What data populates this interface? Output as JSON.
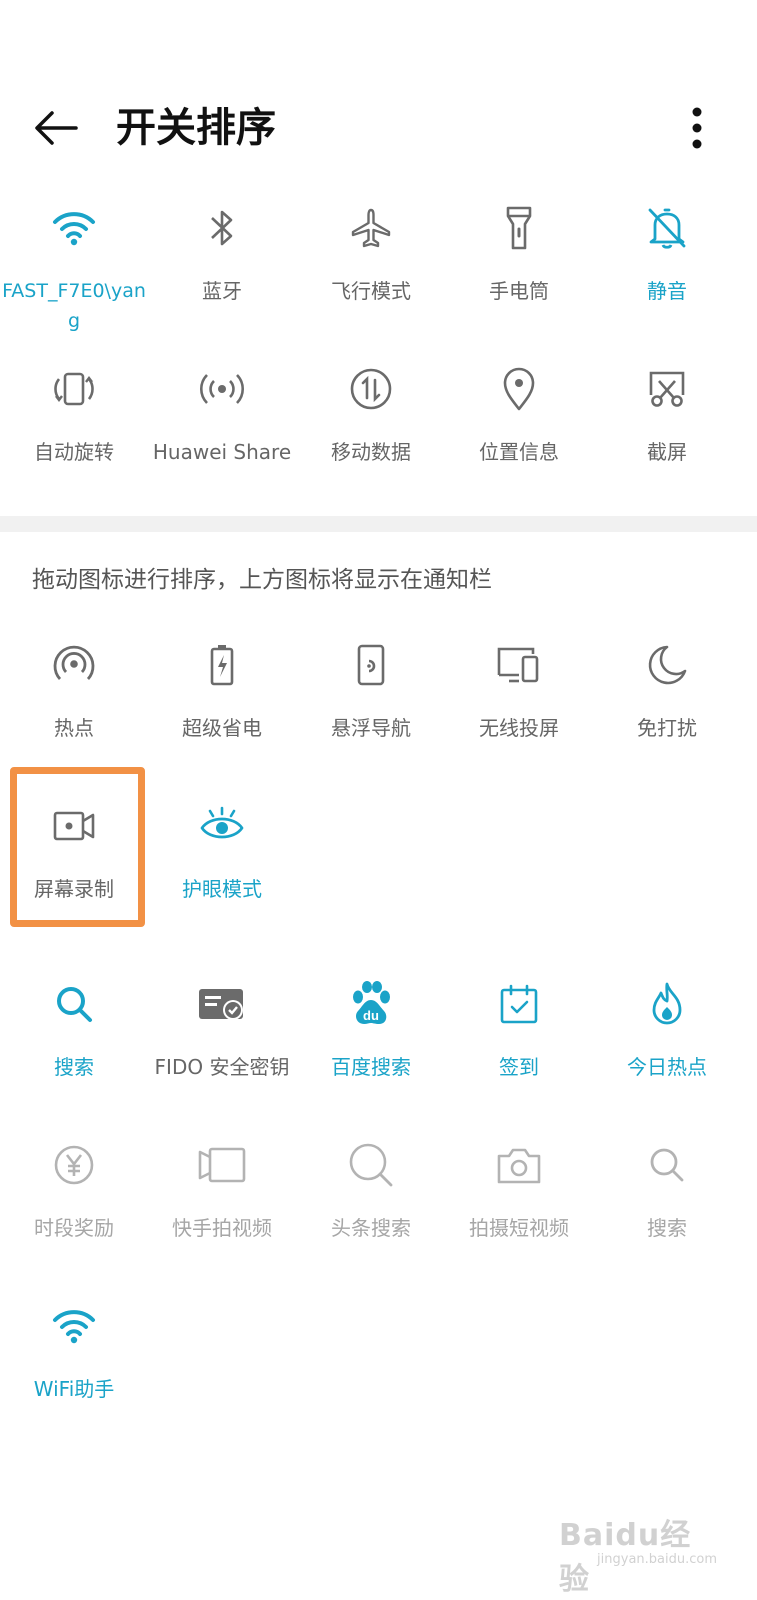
{
  "header": {
    "title": "开关排序"
  },
  "colors": {
    "active": "#1aa3c8",
    "inactive": "#6b6b6b",
    "faded": "#b3b3b3",
    "highlight": "#f29145"
  },
  "notification_tiles": [
    {
      "label": "FAST_F7E0\\yang",
      "icon": "wifi-icon",
      "state": "on"
    },
    {
      "label": "蓝牙",
      "icon": "bluetooth-icon",
      "state": "off"
    },
    {
      "label": "飞行模式",
      "icon": "airplane-icon",
      "state": "off"
    },
    {
      "label": "手电筒",
      "icon": "flashlight-icon",
      "state": "off"
    },
    {
      "label": "静音",
      "icon": "mute-bell-icon",
      "state": "on"
    },
    {
      "label": "自动旋转",
      "icon": "auto-rotate-icon",
      "state": "off"
    },
    {
      "label": "Huawei Share",
      "icon": "huawei-share-icon",
      "state": "off"
    },
    {
      "label": "移动数据",
      "icon": "mobile-data-icon",
      "state": "off"
    },
    {
      "label": "位置信息",
      "icon": "location-pin-icon",
      "state": "off"
    },
    {
      "label": "截屏",
      "icon": "screenshot-icon",
      "state": "off"
    }
  ],
  "hint": "拖动图标进行排序，上方图标将显示在通知栏",
  "other_tiles": [
    {
      "label": "热点",
      "icon": "hotspot-icon",
      "state": "off"
    },
    {
      "label": "超级省电",
      "icon": "battery-saver-icon",
      "state": "off"
    },
    {
      "label": "悬浮导航",
      "icon": "floating-nav-icon",
      "state": "off"
    },
    {
      "label": "无线投屏",
      "icon": "wireless-projection-icon",
      "state": "off"
    },
    {
      "label": "免打扰",
      "icon": "moon-icon",
      "state": "off"
    },
    {
      "label": "屏幕录制",
      "icon": "screen-record-icon",
      "state": "off"
    },
    {
      "label": "护眼模式",
      "icon": "eye-icon",
      "state": "on"
    }
  ],
  "app_tiles": [
    {
      "label": "搜索",
      "icon": "search-icon",
      "state": "on"
    },
    {
      "label": "FIDO 安全密钥",
      "icon": "fido-key-icon",
      "state": "off"
    },
    {
      "label": "百度搜索",
      "icon": "baidu-paw-icon",
      "state": "on"
    },
    {
      "label": "签到",
      "icon": "calendar-check-icon",
      "state": "on"
    },
    {
      "label": "今日热点",
      "icon": "flame-icon",
      "state": "on"
    },
    {
      "label": "时段奖励",
      "icon": "yuan-coin-icon",
      "state": "faded"
    },
    {
      "label": "快手拍视频",
      "icon": "kuaishou-video-icon",
      "state": "faded"
    },
    {
      "label": "头条搜索",
      "icon": "search-icon",
      "state": "faded"
    },
    {
      "label": "拍摄短视频",
      "icon": "camera-icon",
      "state": "faded"
    },
    {
      "label": "搜索",
      "icon": "search-icon",
      "state": "faded"
    },
    {
      "label": "WiFi助手",
      "icon": "wifi-icon",
      "state": "on"
    }
  ],
  "watermark": {
    "main": "Baidu经验",
    "sub": "jingyan.baidu.com"
  }
}
